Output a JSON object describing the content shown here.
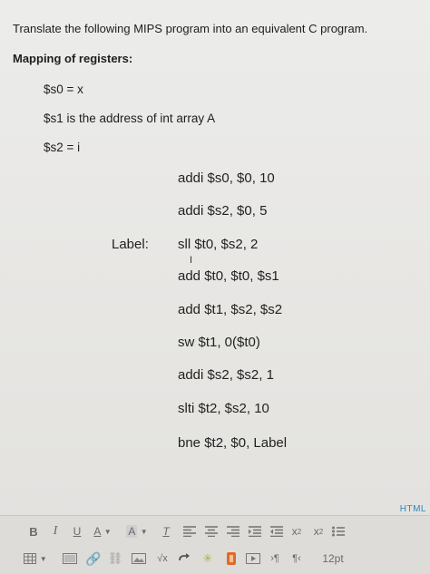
{
  "question": {
    "title": "Translate the following MIPS program into an equivalent C program.",
    "mapping_heading": "Mapping of registers:",
    "mapping": [
      "$s0 = x",
      "$s1 is the address of int array A",
      "$s2 = i"
    ]
  },
  "code": {
    "label": "Label:",
    "lines": [
      "addi $s0, $0, 10",
      "addi $s2, $0, 5",
      "sll $t0, $s2, 2",
      "add $t0, $t0, $s1",
      "add $t1, $s2, $s2",
      "sw $t1, 0($t0)",
      "addi $s2, $s2, 1",
      "slti $t2, $s2, 10",
      "bne $t2, $0, Label"
    ]
  },
  "editor": {
    "html_label": "HTML",
    "font_size": "12pt",
    "icons": [
      "bold-icon",
      "italic-icon",
      "underline-icon",
      "font-color-icon",
      "highlight-color-icon",
      "clear-formatting-icon",
      "align-left-icon",
      "align-center-icon",
      "align-right-icon",
      "indent-icon",
      "outdent-icon",
      "superscript-icon",
      "subscript-icon",
      "bullet-list-icon",
      "table-icon",
      "media-icon",
      "link-icon",
      "unlink-icon",
      "image-icon",
      "equation-icon",
      "embed-icon",
      "accessibility-icon",
      "flash-icon",
      "preview-icon",
      "ltr-icon",
      "rtl-icon"
    ]
  }
}
